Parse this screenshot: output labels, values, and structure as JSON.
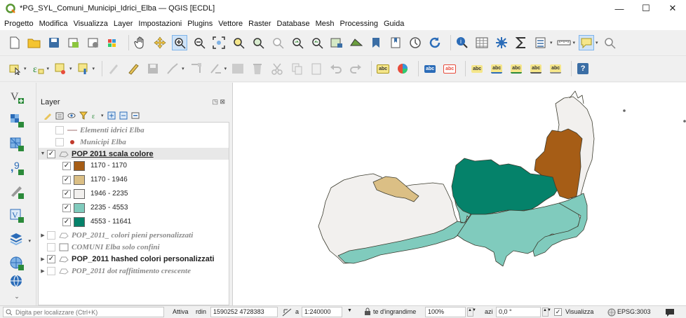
{
  "window": {
    "title": "*PG_SYL_Comuni_Municipi_Idrici_Elba — QGIS [ECDL]",
    "minimize": "—",
    "maximize": "☐",
    "close": "✕"
  },
  "menu": [
    "Progetto",
    "Modifica",
    "Visualizza",
    "Layer",
    "Impostazioni",
    "Plugins",
    "Vettore",
    "Raster",
    "Database",
    "Mesh",
    "Processing",
    "Guida"
  ],
  "toolbar2_labels": {
    "abc": "abc",
    "help": "?"
  },
  "layers_panel": {
    "title": "Layer",
    "buttons": "◳ ⊠",
    "layers": [
      {
        "name": "Elementi idrici Elba",
        "checked": false,
        "style": "dim",
        "icon": "line-icon"
      },
      {
        "name": "Municipi Elba",
        "checked": false,
        "style": "dim",
        "icon": "point-icon"
      },
      {
        "name": "POP 2011 scala colore",
        "checked": true,
        "style": "u",
        "icon": "polygon-icon",
        "expanded": true
      },
      {
        "name": "POP_2011_ colori pieni personalizzati",
        "checked": false,
        "style": "dim",
        "icon": "polygon-icon",
        "expanded": false
      },
      {
        "name": "COMUNI Elba solo confini",
        "checked": false,
        "style": "dim",
        "icon": "none"
      },
      {
        "name": "POP_2011 hashed colori personalizzati",
        "checked": true,
        "style": "bold",
        "icon": "polygon-icon",
        "expanded": false
      },
      {
        "name": "POP_2011 dot raffittimento crescente",
        "checked": false,
        "style": "dim",
        "icon": "polygon-icon",
        "expanded": false
      }
    ],
    "categories": [
      {
        "label": "1170 - 1170",
        "color": "#a65d16",
        "checked": true
      },
      {
        "label": "1170 - 1946",
        "color": "#dbbf85",
        "checked": true
      },
      {
        "label": "1946 - 2235",
        "color": "#f2f0ee",
        "checked": true
      },
      {
        "label": "2235 - 4553",
        "color": "#80cbbd",
        "checked": true
      },
      {
        "label": "4553 - 11641",
        "color": "#05826a",
        "checked": true
      }
    ]
  },
  "statusbar": {
    "search_placeholder": "Digita per localizzare (Ctrl+K)",
    "toggle": "Attiva",
    "coord_label": "rdin",
    "coordinate": "1590252 4728383",
    "scale_label": "a",
    "scale": "1:240000",
    "magnifier_label": "te d'ingrandime",
    "magnifier": "100%",
    "rotation_label": "azi",
    "rotation": "0,0 °",
    "render_label": "Visualizza",
    "render_checked": true,
    "crs": "EPSG:3003"
  },
  "colors": {
    "brown": "#a65d16",
    "tan": "#dbbf85",
    "light": "#f2f0ee",
    "teal": "#80cbbd",
    "dark_teal": "#05826a",
    "outline": "#3b3b2e"
  }
}
